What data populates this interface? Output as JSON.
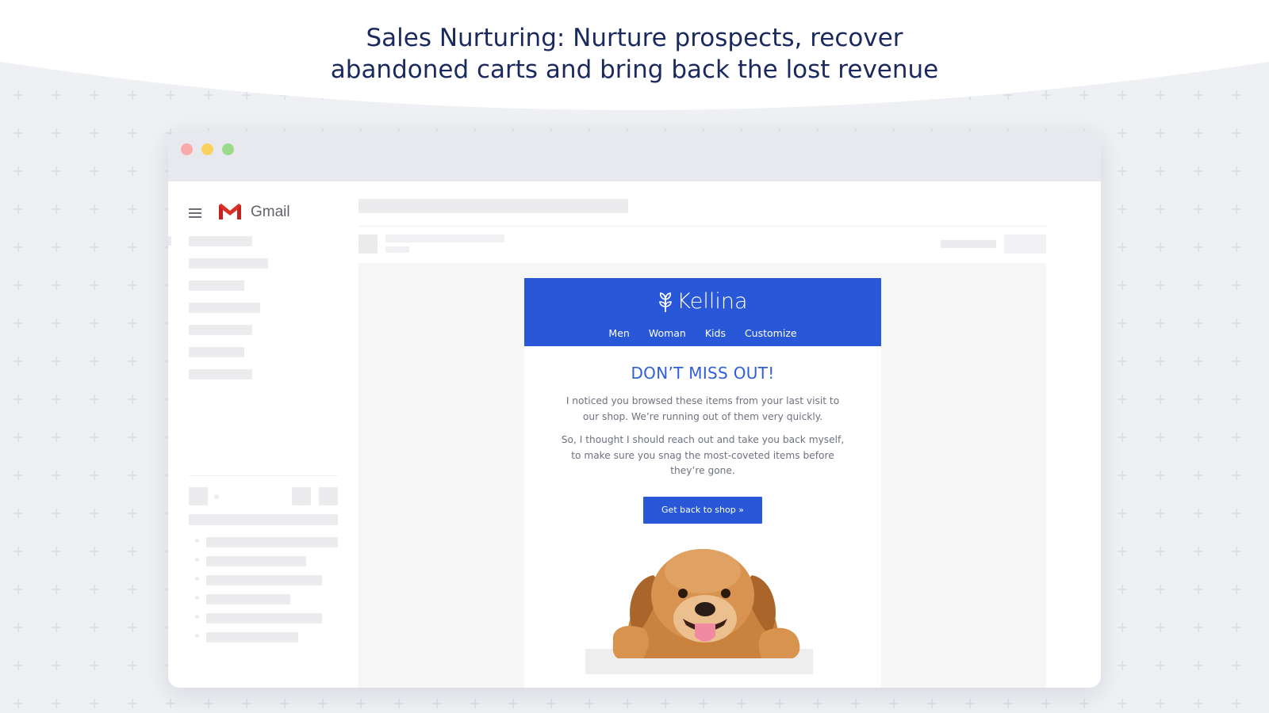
{
  "headline": {
    "line1": "Sales Nurturing: Nurture prospects, recover",
    "line2": "abandoned carts and bring back the lost revenue"
  },
  "colors": {
    "headline": "#1b2a5e",
    "accent_blue": "#2857d8",
    "heading_blue": "#2f5ed6",
    "background": "#eef0f3"
  },
  "browser": {
    "window_controls": [
      "close",
      "minimize",
      "maximize"
    ]
  },
  "gmail": {
    "menu_icon": "hamburger-menu-icon",
    "logo_icon": "gmail-logo-icon",
    "app_name": "Gmail"
  },
  "email": {
    "brand": "Kellina",
    "brand_icon": "sprout-icon",
    "nav": [
      "Men",
      "Woman",
      "Kids",
      "Customize"
    ],
    "heading": "DON’T MISS OUT!",
    "paragraph1": "I noticed you browsed these items from your last visit to our shop. We’re running out of them very quickly.",
    "paragraph2": "So, I thought I should reach out and take you back myself, to make sure you snag the most-coveted items before they’re gone.",
    "cta_label": "Get back to shop »",
    "image": "golden-retriever-dog-image"
  }
}
